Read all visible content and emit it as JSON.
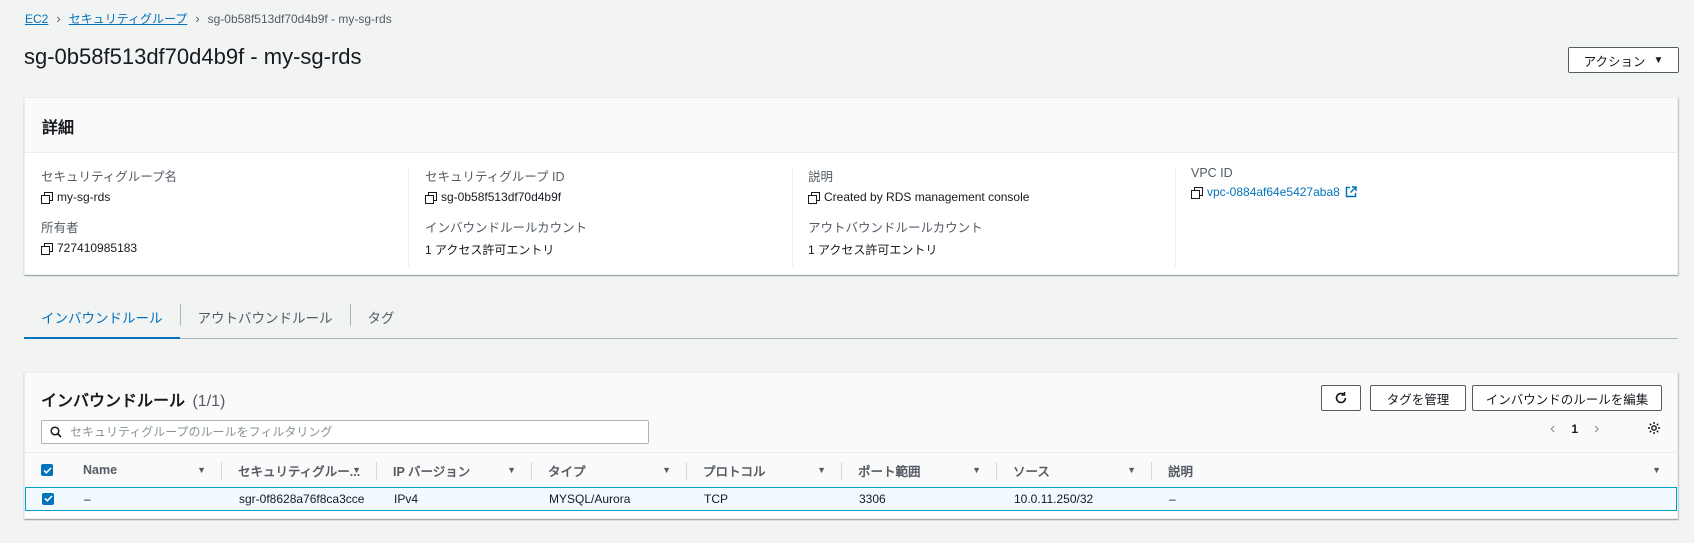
{
  "breadcrumb": {
    "items": [
      "EC2",
      "セキュリティグループ"
    ],
    "current": "sg-0b58f513df70d4b9f - my-sg-rds"
  },
  "page_title": "sg-0b58f513df70d4b9f - my-sg-rds",
  "actions_label": "アクション",
  "details": {
    "title": "詳細",
    "fields": {
      "sg_name": {
        "label": "セキュリティグループ名",
        "value": "my-sg-rds"
      },
      "sg_id": {
        "label": "セキュリティグループ ID",
        "value": "sg-0b58f513df70d4b9f"
      },
      "description": {
        "label": "説明",
        "value": "Created by RDS management console"
      },
      "vpc_id": {
        "label": "VPC ID",
        "value": "vpc-0884af64e5427aba8"
      },
      "owner": {
        "label": "所有者",
        "value": "727410985183"
      },
      "inbound_count": {
        "label": "インバウンドルールカウント",
        "value": "1 アクセス許可エントリ"
      },
      "outbound_count": {
        "label": "アウトバウンドルールカウント",
        "value": "1 アクセス許可エントリ"
      }
    }
  },
  "tabs": [
    "インバウンドルール",
    "アウトバウンドルール",
    "タグ"
  ],
  "active_tab": 0,
  "rules": {
    "title": "インバウンドルール",
    "count": "(1/1)",
    "manage_tags_label": "タグを管理",
    "edit_label": "インバウンドのルールを編集",
    "filter_placeholder": "セキュリティグループのルールをフィルタリング",
    "page": "1",
    "columns": [
      "Name",
      "セキュリティグルー...",
      "IP バージョン",
      "タイプ",
      "プロトコル",
      "ポート範囲",
      "ソース",
      "説明"
    ],
    "rows": [
      {
        "name": "–",
        "sg_rule_id": "sgr-0f8628a76f8ca3cce",
        "ip_version": "IPv4",
        "type": "MYSQL/Aurora",
        "protocol": "TCP",
        "port_range": "3306",
        "source": "10.0.11.250/32",
        "description": "–"
      }
    ]
  },
  "colors": {
    "link": "#0073bb",
    "selected_row_border": "#00a1c9",
    "selected_row_bg": "#f1faff"
  }
}
